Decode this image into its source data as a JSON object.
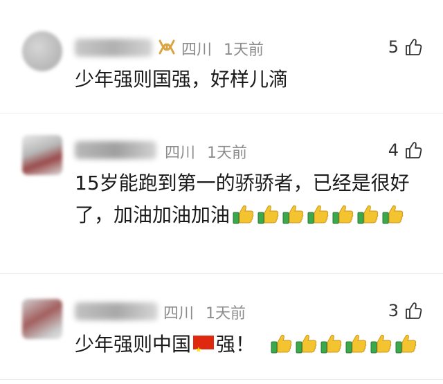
{
  "comments": [
    {
      "location": "四川",
      "time": "1天前",
      "likes": "5",
      "text": "少年强则国强，好样儿滴",
      "has_badge": true,
      "thumbs_count": 0
    },
    {
      "location": "四川",
      "time": "1天前",
      "likes": "4",
      "text": "15岁能跑到第一的骄骄者，已经是很好了，加油加油加油",
      "thumbs_count": 7
    },
    {
      "location": "四川",
      "time": "1天前",
      "likes": "3",
      "text_before_flag": "少年强则中国",
      "text_after_flag": "强！",
      "thumbs_count": 6
    }
  ],
  "icons": {
    "like": "thumbs-up-outline-icon",
    "badge": "gold-ribbon-badge-icon",
    "emoji": "thumbs-up-emoji-icon",
    "flag": "china-flag-emoji-icon"
  },
  "colors": {
    "meta_text": "#8c8c8c",
    "badge_gold": "#d9a441",
    "thumb_yellow": "#f4c430",
    "thumb_green": "#3aa84b",
    "flag_red": "#de2910"
  }
}
